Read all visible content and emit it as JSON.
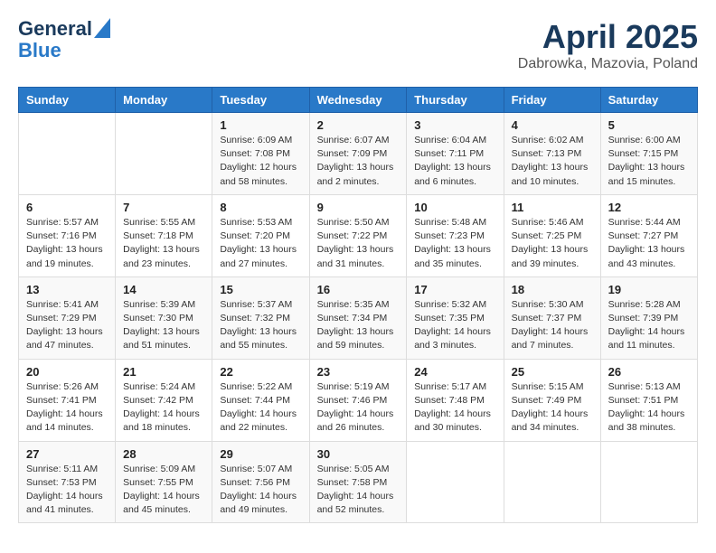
{
  "logo": {
    "line1": "General",
    "line2": "Blue"
  },
  "title": "April 2025",
  "subtitle": "Dabrowka, Mazovia, Poland",
  "weekdays": [
    "Sunday",
    "Monday",
    "Tuesday",
    "Wednesday",
    "Thursday",
    "Friday",
    "Saturday"
  ],
  "weeks": [
    [
      {
        "day": "",
        "info": ""
      },
      {
        "day": "",
        "info": ""
      },
      {
        "day": "1",
        "info": "Sunrise: 6:09 AM\nSunset: 7:08 PM\nDaylight: 12 hours and 58 minutes."
      },
      {
        "day": "2",
        "info": "Sunrise: 6:07 AM\nSunset: 7:09 PM\nDaylight: 13 hours and 2 minutes."
      },
      {
        "day": "3",
        "info": "Sunrise: 6:04 AM\nSunset: 7:11 PM\nDaylight: 13 hours and 6 minutes."
      },
      {
        "day": "4",
        "info": "Sunrise: 6:02 AM\nSunset: 7:13 PM\nDaylight: 13 hours and 10 minutes."
      },
      {
        "day": "5",
        "info": "Sunrise: 6:00 AM\nSunset: 7:15 PM\nDaylight: 13 hours and 15 minutes."
      }
    ],
    [
      {
        "day": "6",
        "info": "Sunrise: 5:57 AM\nSunset: 7:16 PM\nDaylight: 13 hours and 19 minutes."
      },
      {
        "day": "7",
        "info": "Sunrise: 5:55 AM\nSunset: 7:18 PM\nDaylight: 13 hours and 23 minutes."
      },
      {
        "day": "8",
        "info": "Sunrise: 5:53 AM\nSunset: 7:20 PM\nDaylight: 13 hours and 27 minutes."
      },
      {
        "day": "9",
        "info": "Sunrise: 5:50 AM\nSunset: 7:22 PM\nDaylight: 13 hours and 31 minutes."
      },
      {
        "day": "10",
        "info": "Sunrise: 5:48 AM\nSunset: 7:23 PM\nDaylight: 13 hours and 35 minutes."
      },
      {
        "day": "11",
        "info": "Sunrise: 5:46 AM\nSunset: 7:25 PM\nDaylight: 13 hours and 39 minutes."
      },
      {
        "day": "12",
        "info": "Sunrise: 5:44 AM\nSunset: 7:27 PM\nDaylight: 13 hours and 43 minutes."
      }
    ],
    [
      {
        "day": "13",
        "info": "Sunrise: 5:41 AM\nSunset: 7:29 PM\nDaylight: 13 hours and 47 minutes."
      },
      {
        "day": "14",
        "info": "Sunrise: 5:39 AM\nSunset: 7:30 PM\nDaylight: 13 hours and 51 minutes."
      },
      {
        "day": "15",
        "info": "Sunrise: 5:37 AM\nSunset: 7:32 PM\nDaylight: 13 hours and 55 minutes."
      },
      {
        "day": "16",
        "info": "Sunrise: 5:35 AM\nSunset: 7:34 PM\nDaylight: 13 hours and 59 minutes."
      },
      {
        "day": "17",
        "info": "Sunrise: 5:32 AM\nSunset: 7:35 PM\nDaylight: 14 hours and 3 minutes."
      },
      {
        "day": "18",
        "info": "Sunrise: 5:30 AM\nSunset: 7:37 PM\nDaylight: 14 hours and 7 minutes."
      },
      {
        "day": "19",
        "info": "Sunrise: 5:28 AM\nSunset: 7:39 PM\nDaylight: 14 hours and 11 minutes."
      }
    ],
    [
      {
        "day": "20",
        "info": "Sunrise: 5:26 AM\nSunset: 7:41 PM\nDaylight: 14 hours and 14 minutes."
      },
      {
        "day": "21",
        "info": "Sunrise: 5:24 AM\nSunset: 7:42 PM\nDaylight: 14 hours and 18 minutes."
      },
      {
        "day": "22",
        "info": "Sunrise: 5:22 AM\nSunset: 7:44 PM\nDaylight: 14 hours and 22 minutes."
      },
      {
        "day": "23",
        "info": "Sunrise: 5:19 AM\nSunset: 7:46 PM\nDaylight: 14 hours and 26 minutes."
      },
      {
        "day": "24",
        "info": "Sunrise: 5:17 AM\nSunset: 7:48 PM\nDaylight: 14 hours and 30 minutes."
      },
      {
        "day": "25",
        "info": "Sunrise: 5:15 AM\nSunset: 7:49 PM\nDaylight: 14 hours and 34 minutes."
      },
      {
        "day": "26",
        "info": "Sunrise: 5:13 AM\nSunset: 7:51 PM\nDaylight: 14 hours and 38 minutes."
      }
    ],
    [
      {
        "day": "27",
        "info": "Sunrise: 5:11 AM\nSunset: 7:53 PM\nDaylight: 14 hours and 41 minutes."
      },
      {
        "day": "28",
        "info": "Sunrise: 5:09 AM\nSunset: 7:55 PM\nDaylight: 14 hours and 45 minutes."
      },
      {
        "day": "29",
        "info": "Sunrise: 5:07 AM\nSunset: 7:56 PM\nDaylight: 14 hours and 49 minutes."
      },
      {
        "day": "30",
        "info": "Sunrise: 5:05 AM\nSunset: 7:58 PM\nDaylight: 14 hours and 52 minutes."
      },
      {
        "day": "",
        "info": ""
      },
      {
        "day": "",
        "info": ""
      },
      {
        "day": "",
        "info": ""
      }
    ]
  ]
}
